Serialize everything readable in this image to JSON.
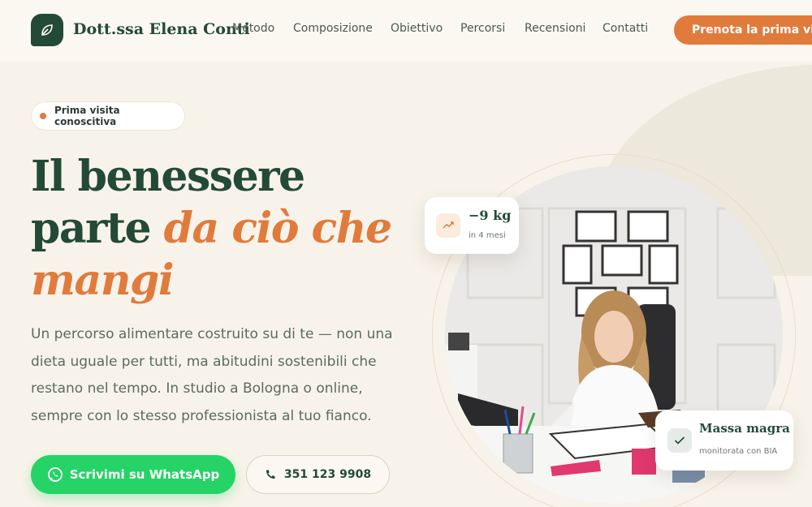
{
  "nav": {
    "brand": "Dott.ssa Elena Conti",
    "links": [
      "Metodo",
      "Composizione",
      "Obiettivo",
      "Percorsi",
      "Recensioni",
      "Contatti"
    ],
    "cta": "Prenota la prima visita"
  },
  "hero": {
    "badge": "Prima visita conoscitiva",
    "title_line1": "Il benessere",
    "title_line2_plain": "parte",
    "title_line2_accent": "da ciò che",
    "title_line3_accent": "mangi",
    "lead": "Un percorso alimentare costruito su di te — non una dieta uguale per tutti, ma abitudini sostenibili che restano nel tempo. In studio a Bologna o online, sempre con lo stesso professionista al tuo fianco.",
    "whatsapp_label": "Scrivimi su WhatsApp",
    "phone_label": "351 123 9908"
  },
  "cards": {
    "weight_value": "−9 kg",
    "weight_caption": "in 4 mesi",
    "lean_title": "Massa magra",
    "lean_caption": "monitorata con BIA"
  },
  "icons": {
    "logo": "leaf-icon",
    "whatsapp": "whatsapp-icon",
    "phone": "phone-icon",
    "trend": "trend-up-icon",
    "check": "check-icon"
  },
  "colors": {
    "primary_green": "#234a37",
    "accent_orange": "#e07b3c",
    "whatsapp_green": "#25d366",
    "background": "#f8f3ea"
  }
}
